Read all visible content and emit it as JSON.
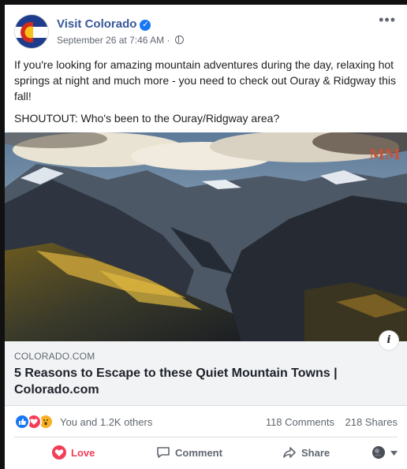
{
  "post": {
    "page_name": "Visit Colorado",
    "timestamp": "September 26 at 7:46 AM",
    "meta_separator": "·",
    "more_label": "•••",
    "text_paragraphs": [
      "If you're looking for amazing mountain adventures during the day, relaxing hot springs at night and much more - you need to check out Ouray & Ridgway this fall!",
      "SHOUTOUT: Who's been to the Ouray/Ridgway area?"
    ]
  },
  "link_card": {
    "domain": "COLORADO.COM",
    "title": "5 Reasons to Escape to these Quiet Mountain Towns | Colorado.com",
    "info_label": "i"
  },
  "reactions": {
    "icons": [
      "like-icon",
      "love-icon",
      "wow-icon"
    ],
    "summary": "You and 1.2K others",
    "comments": "118 Comments",
    "shares": "218 Shares"
  },
  "actions": {
    "love": "Love",
    "comment": "Comment",
    "share": "Share"
  },
  "colors": {
    "page_name": "#385898",
    "verified": "#1877f2",
    "love": "#f33e58",
    "wow": "#f7b125",
    "secondary_text": "#606770",
    "link_card_bg": "#f2f3f5"
  }
}
